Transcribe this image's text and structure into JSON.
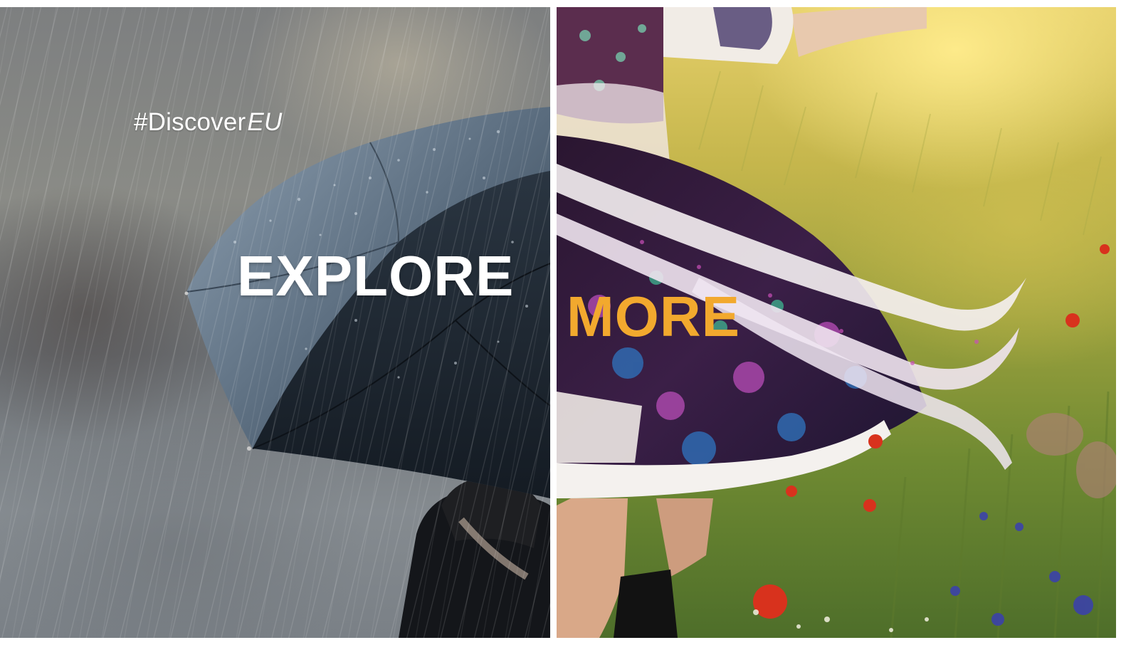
{
  "banner": {
    "hashtag_prefix": "#Discover",
    "hashtag_suffix": "EU",
    "headline_left": "EXPLORE",
    "headline_right": "MORE"
  },
  "colors": {
    "headline_left": "#ffffff",
    "headline_right": "#f2a92e",
    "hashtag": "#ffffff"
  },
  "images": {
    "left": "person-with-umbrella-in-rain",
    "right": "traditional-embroidered-dress-in-wheat-field"
  }
}
